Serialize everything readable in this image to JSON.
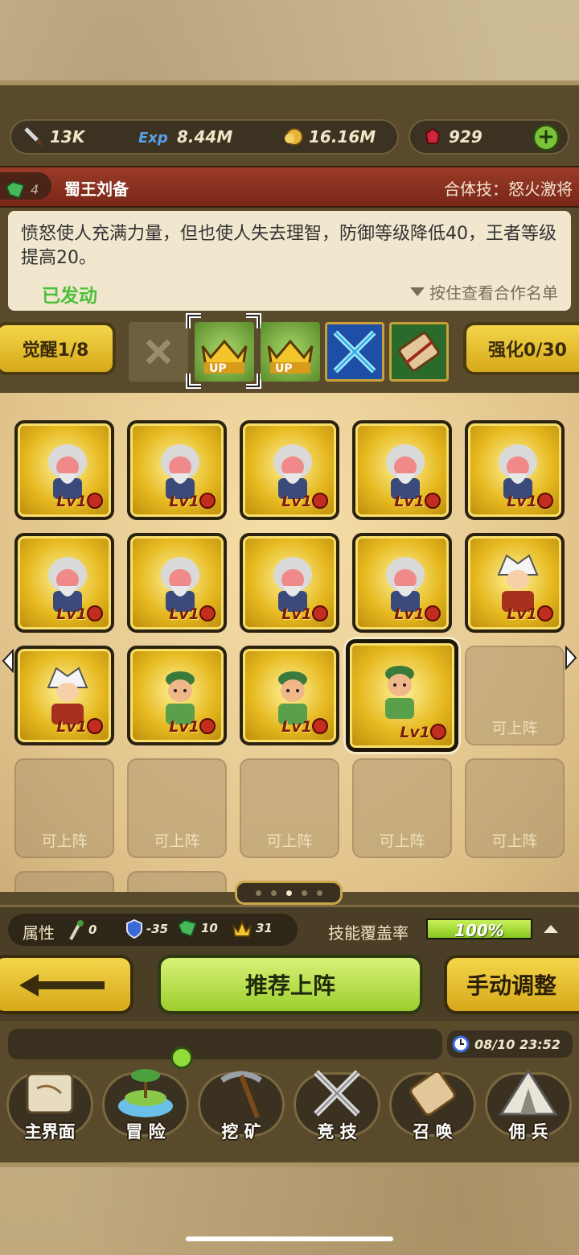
{
  "resources": {
    "power": "13K",
    "exp": "8.44M",
    "gold": "16.16M",
    "gems": "929"
  },
  "hero": {
    "level": "4",
    "name": "蜀王刘备",
    "combo": "合体技：怒火激将"
  },
  "skill": {
    "description": "愤怒使人充满力量，但也使人失去理智，防御等级降低40，王者等级提高20。",
    "status": "已发动",
    "hint": "按住查看合作名单"
  },
  "awaken": {
    "awaken_label": "觉醒1/8",
    "enhance_label": "强化0/30"
  },
  "slots": [
    {
      "type": "hero",
      "avatar": "old-sage",
      "level": "Lv1"
    },
    {
      "type": "hero",
      "avatar": "old-sage",
      "level": "Lv1"
    },
    {
      "type": "hero",
      "avatar": "old-sage",
      "level": "Lv1"
    },
    {
      "type": "hero",
      "avatar": "old-sage",
      "level": "Lv1"
    },
    {
      "type": "hero",
      "avatar": "old-sage",
      "level": "Lv1"
    },
    {
      "type": "hero",
      "avatar": "old-sage",
      "level": "Lv1"
    },
    {
      "type": "hero",
      "avatar": "old-sage",
      "level": "Lv1"
    },
    {
      "type": "hero",
      "avatar": "old-sage",
      "level": "Lv1"
    },
    {
      "type": "hero",
      "avatar": "old-sage",
      "level": "Lv1"
    },
    {
      "type": "hero",
      "avatar": "white-hair",
      "level": "Lv1"
    },
    {
      "type": "hero",
      "avatar": "white-hair",
      "level": "Lv1"
    },
    {
      "type": "hero",
      "avatar": "green-cap",
      "level": "Lv1"
    },
    {
      "type": "hero",
      "avatar": "green-cap",
      "level": "Lv1"
    },
    {
      "type": "hero",
      "avatar": "green-cap",
      "level": "Lv1",
      "selected": true
    },
    {
      "type": "empty",
      "label": "可上阵"
    },
    {
      "type": "empty",
      "label": "可上阵"
    },
    {
      "type": "empty",
      "label": "可上阵"
    },
    {
      "type": "empty",
      "label": "可上阵"
    },
    {
      "type": "empty",
      "label": "可上阵"
    },
    {
      "type": "empty",
      "label": "可上阵"
    }
  ],
  "pager": {
    "count": 5,
    "active": 2
  },
  "attributes": {
    "label": "属性",
    "attack": "0",
    "defense": "-35",
    "gem": "10",
    "crown": "31",
    "coverage_label": "技能覆盖率",
    "coverage_value": "100%",
    "coverage_fraction": 1.0
  },
  "actions": {
    "recommend": "推荐上阵",
    "manual": "手动调整"
  },
  "status": {
    "datetime": "08/10 23:52"
  },
  "nav": [
    {
      "label": "主界面",
      "icon": "map-scroll-icon"
    },
    {
      "label": "冒 险",
      "icon": "island-icon"
    },
    {
      "label": "挖 矿",
      "icon": "pickaxe-icon"
    },
    {
      "label": "竞 技",
      "icon": "crossed-swords-icon"
    },
    {
      "label": "召 唤",
      "icon": "summon-scroll-icon"
    },
    {
      "label": "佣 兵",
      "icon": "tent-icon"
    }
  ],
  "colors": {
    "accent_green": "#9ccd2c",
    "gold": "#e6b920",
    "banner_red": "#9a3b28"
  }
}
